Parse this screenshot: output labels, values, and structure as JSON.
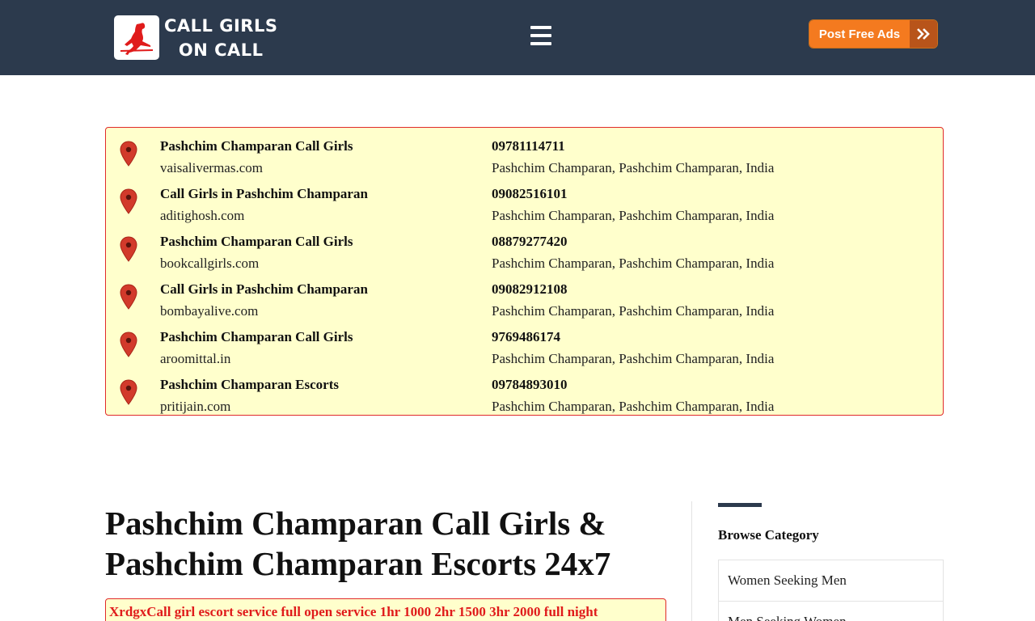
{
  "header": {
    "logo_line1": "CALL GIRLS",
    "logo_line2": "ON CALL",
    "menu_icon": "hamburger-menu-icon",
    "post_button_label": "Post Free Ads",
    "post_button_icon": "double-chevron-right-icon",
    "bg_color": "#2c3a4d",
    "accent_color": "#f47a1f"
  },
  "listings": [
    {
      "title": "Pashchim Champaran Call Girls",
      "site": "vaisalivermas.com",
      "phone": "09781114711",
      "location": "Pashchim Champaran, Pashchim Champaran, India"
    },
    {
      "title": "Call Girls in Pashchim Champaran",
      "site": "aditighosh.com",
      "phone": "09082516101",
      "location": "Pashchim Champaran, Pashchim Champaran, India"
    },
    {
      "title": "Pashchim Champaran Call Girls",
      "site": "bookcallgirls.com",
      "phone": "08879277420",
      "location": "Pashchim Champaran, Pashchim Champaran, India"
    },
    {
      "title": "Call Girls in Pashchim Champaran",
      "site": "bombayalive.com",
      "phone": "09082912108",
      "location": "Pashchim Champaran, Pashchim Champaran, India"
    },
    {
      "title": "Pashchim Champaran Call Girls",
      "site": "aroomittal.in",
      "phone": "9769486174",
      "location": "Pashchim Champaran, Pashchim Champaran, India"
    },
    {
      "title": "Pashchim Champaran Escorts",
      "site": "pritijain.com",
      "phone": "09784893010",
      "location": "Pashchim Champaran, Pashchim Champaran, India"
    }
  ],
  "main": {
    "title": "Pashchim Champaran Call Girls & Pashchim Champaran Escorts 24x7",
    "promo_text": "XrdgxCall girl escort service full open service 1hr 1000 2hr 1500 3hr 2000 full night"
  },
  "sidebar": {
    "title": "Browse Category",
    "items": [
      "Women Seeking Men",
      "Men Seeking Women"
    ]
  }
}
